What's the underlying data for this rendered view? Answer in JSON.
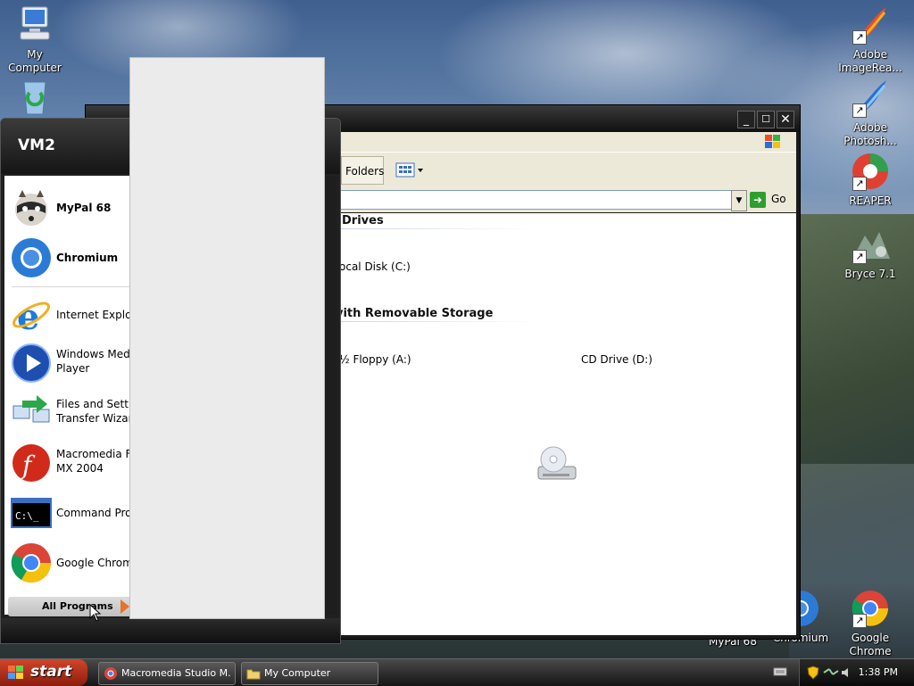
{
  "desktop": {
    "icons_left": [
      {
        "name": "my-computer",
        "label": "My Computer",
        "icon": "computer-icon"
      },
      {
        "name": "recycle-bin",
        "label": "",
        "icon": "recycle-bin-icon"
      }
    ],
    "icons_right": [
      {
        "label": "Adobe ImageRea...",
        "icon": "imageready-icon"
      },
      {
        "label": "Adobe Photosh...",
        "icon": "photoshop-feather-icon"
      },
      {
        "label": "REAPER",
        "icon": "reaper-icon"
      },
      {
        "label": "Bryce 7.1",
        "icon": "bryce-icon"
      }
    ],
    "icons_bottom": [
      {
        "label": "MyPal 68",
        "icon": "mypal-icon"
      },
      {
        "label": "Chromium",
        "icon": "chromium-icon"
      },
      {
        "label": "Google Chrome",
        "icon": "chrome-icon"
      }
    ]
  },
  "explorer": {
    "toolbar": {
      "folders_label": "Folders",
      "views_icon": "views-icon"
    },
    "address": {
      "value": "",
      "go_label": "Go"
    },
    "sections": [
      {
        "title": "Drives",
        "items": [
          {
            "label": "ocal Disk (C:)",
            "icon": "hard-disk-icon"
          }
        ]
      },
      {
        "title": "vith Removable Storage",
        "items": [
          {
            "label": "½ Floppy (A:)",
            "icon": "floppy-icon"
          },
          {
            "label": "CD Drive (D:)",
            "icon": "cd-drive-icon"
          }
        ]
      }
    ]
  },
  "start_menu": {
    "user": "VM2",
    "pinned": [
      {
        "label": "MyPal 68",
        "icon": "mypal-raccoon-icon"
      },
      {
        "label": "Chromium",
        "icon": "chromium-icon"
      }
    ],
    "recent": [
      {
        "lines": [
          "Internet Explor"
        ],
        "icon": "internet-explorer-icon"
      },
      {
        "lines": [
          "Windows Medi",
          "Player"
        ],
        "icon": "media-player-icon"
      },
      {
        "lines": [
          "Files and Setti",
          "Transfer Wizar"
        ],
        "icon": "transfer-wizard-icon"
      },
      {
        "lines": [
          "Macromedia Fl",
          "MX 2004"
        ],
        "icon": "flash-icon"
      },
      {
        "lines": [
          "Command Pror"
        ],
        "icon": "command-prompt-icon"
      },
      {
        "lines": [
          "Google Chrom"
        ],
        "icon": "chrome-icon"
      }
    ],
    "all_programs_label": "All Programs"
  },
  "taskbar": {
    "start_label": "start",
    "tasks": [
      {
        "label": "Macromedia Studio M...",
        "icon": "chrome-icon"
      },
      {
        "label": "My Computer",
        "icon": "folder-icon"
      }
    ],
    "clock": "1:38 PM"
  },
  "colors": {
    "start_button": "#c0391f",
    "explorer_content": "#ffffff",
    "go_green": "#2e9e2e",
    "all_programs_arrow": "#e6732a"
  }
}
